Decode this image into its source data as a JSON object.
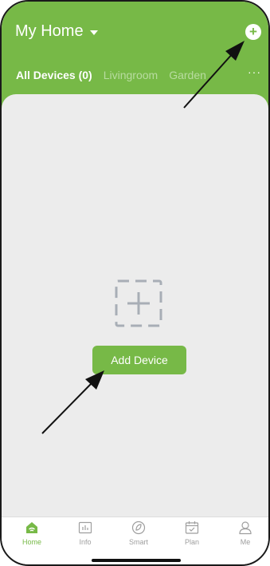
{
  "header": {
    "title": "My Home",
    "title_icon": "chevron-down-icon",
    "add_icon": "plus-circle-icon",
    "more_label": "···",
    "background": "#77b947"
  },
  "tabs": [
    {
      "label": "All Devices (0)",
      "active": true
    },
    {
      "label": "Livingroom",
      "active": false
    },
    {
      "label": "Garden",
      "active": false
    }
  ],
  "main": {
    "placeholder_icon": "dashed-plus-icon",
    "add_device_label": "Add Device"
  },
  "tabbar": {
    "items": [
      {
        "label": "Home",
        "icon": "home-icon",
        "active": true
      },
      {
        "label": "Info",
        "icon": "chart-icon",
        "active": false
      },
      {
        "label": "Smart",
        "icon": "smart-icon",
        "active": false
      },
      {
        "label": "Plan",
        "icon": "calendar-icon",
        "active": false
      },
      {
        "label": "Me",
        "icon": "person-icon",
        "active": false
      }
    ]
  },
  "annotations": {
    "arrow_color": "#111111",
    "arrows": [
      "arrow-to-add-icon",
      "arrow-to-add-device-button"
    ]
  },
  "colors": {
    "accent": "#77b947",
    "inactive": "#9e9e9e",
    "background": "#ececec"
  }
}
